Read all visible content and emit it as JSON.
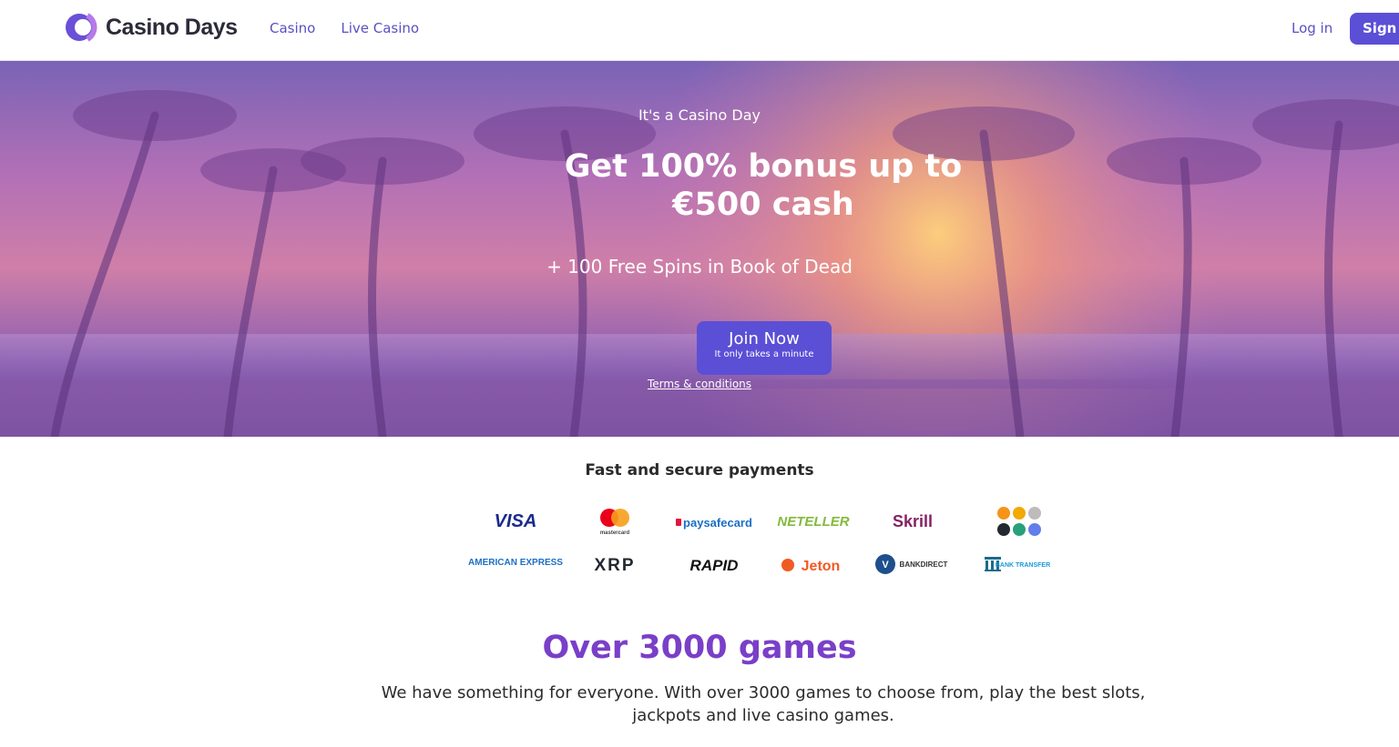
{
  "header": {
    "brand": "Casino Days",
    "nav": [
      "Casino",
      "Live Casino"
    ],
    "login_label": "Log in",
    "signup_label": "Sign up"
  },
  "hero": {
    "subtitle": "It's a Casino Day",
    "title": "Get 100% bonus up to €500 cash",
    "spins": "+ 100 Free Spins in Book of Dead",
    "join_label": "Join Now",
    "join_sub": "It only takes a minute",
    "terms": "Terms & conditions"
  },
  "payments": {
    "title": "Fast and secure payments",
    "methods": [
      {
        "name": "VISA",
        "icon": "visa-logo"
      },
      {
        "name": "mastercard",
        "icon": "mastercard-logo"
      },
      {
        "name": "paysafecard",
        "icon": "paysafecard-logo"
      },
      {
        "name": "NETELLER",
        "icon": "neteller-logo"
      },
      {
        "name": "Skrill",
        "icon": "skrill-logo"
      },
      {
        "name": "crypto",
        "icon": "crypto-coins-logo"
      },
      {
        "name": "AMERICAN EXPRESS",
        "icon": "amex-logo"
      },
      {
        "name": "XRP",
        "icon": "xrp-logo"
      },
      {
        "name": "RAPID",
        "icon": "rapid-logo"
      },
      {
        "name": "Jeton",
        "icon": "jeton-logo"
      },
      {
        "name": "BANKDIRECT",
        "icon": "bankdirect-logo"
      },
      {
        "name": "BANK TRANSFER",
        "icon": "bank-transfer-logo"
      }
    ]
  },
  "games": {
    "title": "Over 3000 games",
    "description": "We have something for everyone. With over 3000 games to choose from, play the best slots, jackpots and live casino games."
  },
  "colors": {
    "accent": "#5b4fd6",
    "games_title": "#7a3fc8",
    "nav_link": "#5a4fc4"
  }
}
